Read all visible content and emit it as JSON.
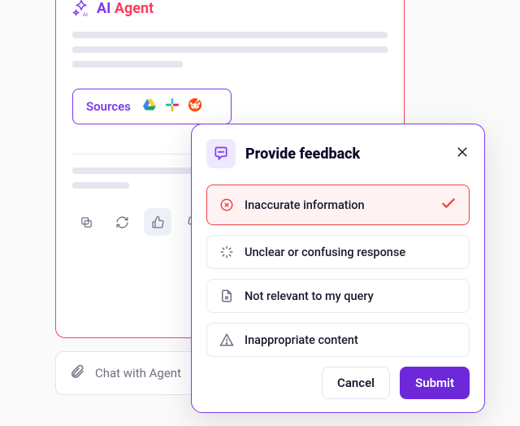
{
  "agent": {
    "ai": "AI",
    "name": "Agent"
  },
  "sources": {
    "label": "Sources",
    "icons": [
      "google-drive",
      "slack",
      "reddit"
    ]
  },
  "actions": {
    "copy": "copy",
    "regenerate": "regenerate",
    "thumbs_up": "thumbs-up",
    "thumbs_down": "thumbs-down",
    "selected": "thumbs_up"
  },
  "chat_input": {
    "placeholder": "Chat with Agent"
  },
  "feedback": {
    "title": "Provide feedback",
    "options": [
      {
        "id": "inaccurate",
        "label": "Inaccurate information",
        "icon": "x-circle",
        "selected": true
      },
      {
        "id": "unclear",
        "label": "Unclear or confusing response",
        "icon": "loading",
        "selected": false
      },
      {
        "id": "irrelevant",
        "label": "Not relevant to my query",
        "icon": "file-x",
        "selected": false
      },
      {
        "id": "inappropriate",
        "label": "Inappropriate content",
        "icon": "warning",
        "selected": false
      }
    ],
    "cancel": "Cancel",
    "submit": "Submit"
  }
}
